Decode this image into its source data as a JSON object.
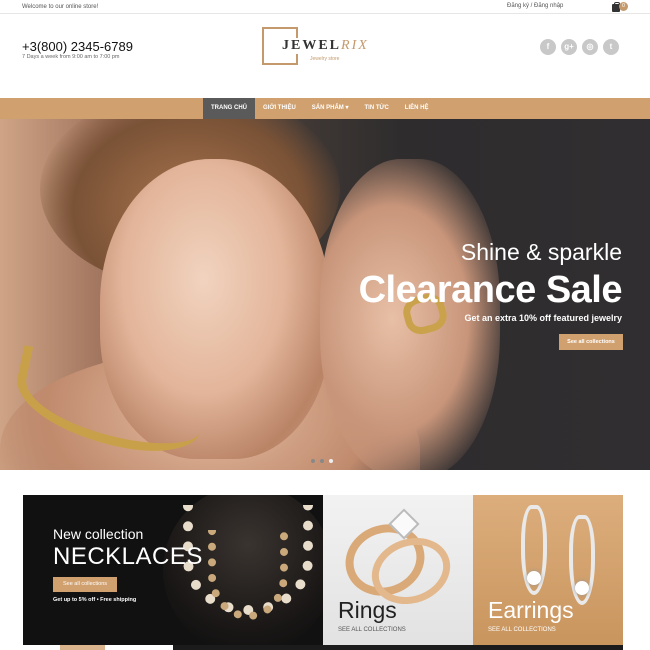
{
  "topbar": {
    "welcome": "Welcome to our online store!",
    "login": "Đăng ký / Đăng nhập",
    "cart_count": "0"
  },
  "header": {
    "phone": "+3(800) 2345-6789",
    "hours": "7 Days a week from 9:00 am to 7:00 pm",
    "logo_part1": "JEWEL",
    "logo_part2": "RIX",
    "logo_tagline": "Jewelry store",
    "social": [
      {
        "icon": "facebook-icon",
        "glyph": "f"
      },
      {
        "icon": "google-plus-icon",
        "glyph": "g+"
      },
      {
        "icon": "instagram-icon",
        "glyph": "◎"
      },
      {
        "icon": "twitter-icon",
        "glyph": "t"
      }
    ]
  },
  "nav": {
    "items": [
      {
        "label": "TRANG CHỦ",
        "active": true
      },
      {
        "label": "GIỚI THIỆU"
      },
      {
        "label": "SẢN PHẨM ▾"
      },
      {
        "label": "TIN TỨC"
      },
      {
        "label": "LIÊN HỆ"
      }
    ]
  },
  "hero": {
    "subtitle": "Shine & sparkle",
    "title": "Clearance Sale",
    "text": "Get an extra 10% off featured jewelry",
    "button": "See all collections",
    "slide_count": 3,
    "active_slide": 3
  },
  "cards": {
    "necklaces": {
      "sub": "New collection",
      "title": "NECKLACES",
      "button": "See all collections",
      "note": "Get up to 5% off • Free shipping"
    },
    "rings": {
      "title": "Rings",
      "link": "SEE ALL COLLECTIONS"
    },
    "earrings": {
      "title": "Earrings",
      "link": "SEE ALL COLLECTIONS"
    }
  },
  "colors": {
    "accent": "#d0a06e",
    "nav_active": "#5a5a5a",
    "badge": "#c49a6c"
  }
}
